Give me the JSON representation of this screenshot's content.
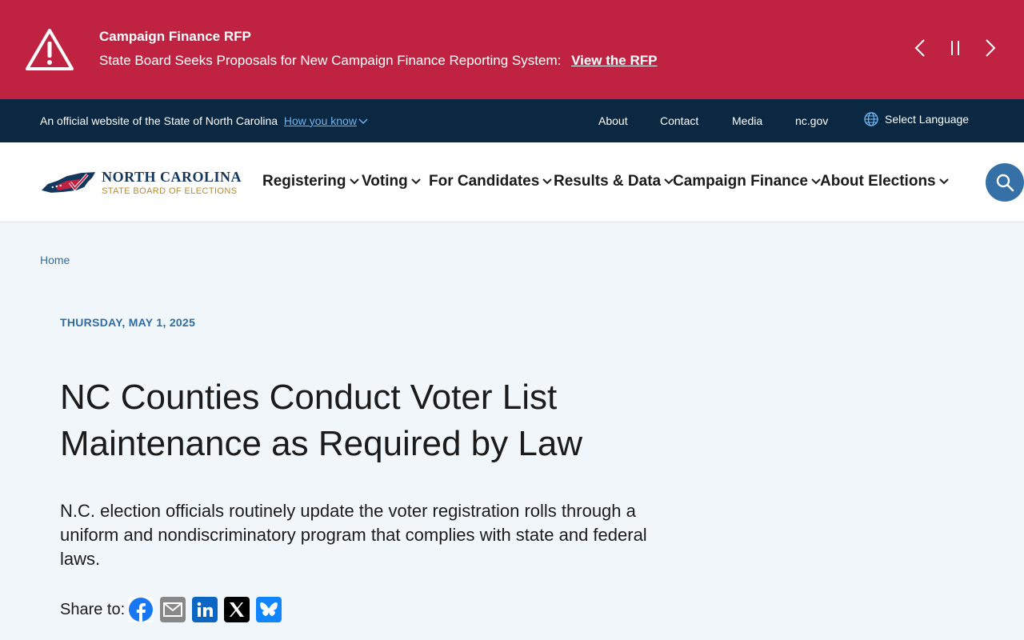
{
  "alert": {
    "title": "Campaign Finance RFP",
    "body": "State Board Seeks Proposals for New Campaign Finance Reporting System:",
    "link": "View the RFP",
    "icon": "warning-triangle-icon"
  },
  "official_bar": {
    "text": "An official website of the State of North Carolina",
    "how_you_know": "How you know",
    "links": [
      "About",
      "Contact",
      "Media",
      "nc.gov"
    ],
    "language": "Select Language"
  },
  "logo": {
    "line1": "NORTH CAROLINA",
    "line2": "STATE BOARD OF ELECTIONS"
  },
  "nav": [
    "Registering",
    "Voting",
    "For Candidates",
    "Results & Data",
    "Campaign Finance",
    "About Elections"
  ],
  "breadcrumb": "Home",
  "article": {
    "date": "THURSDAY, MAY 1, 2025",
    "title": "NC Counties Conduct Voter List Maintenance as Required by Law",
    "lede": "N.C. election officials routinely update the voter registration rolls through a uniform and nondiscriminatory program that complies with state and federal laws.",
    "share_label": "Share to:"
  },
  "colors": {
    "alert_bg": "#bf2341",
    "official_bg": "#0b2842",
    "accent": "#2f6ca3",
    "search_bg": "#3570a6"
  }
}
